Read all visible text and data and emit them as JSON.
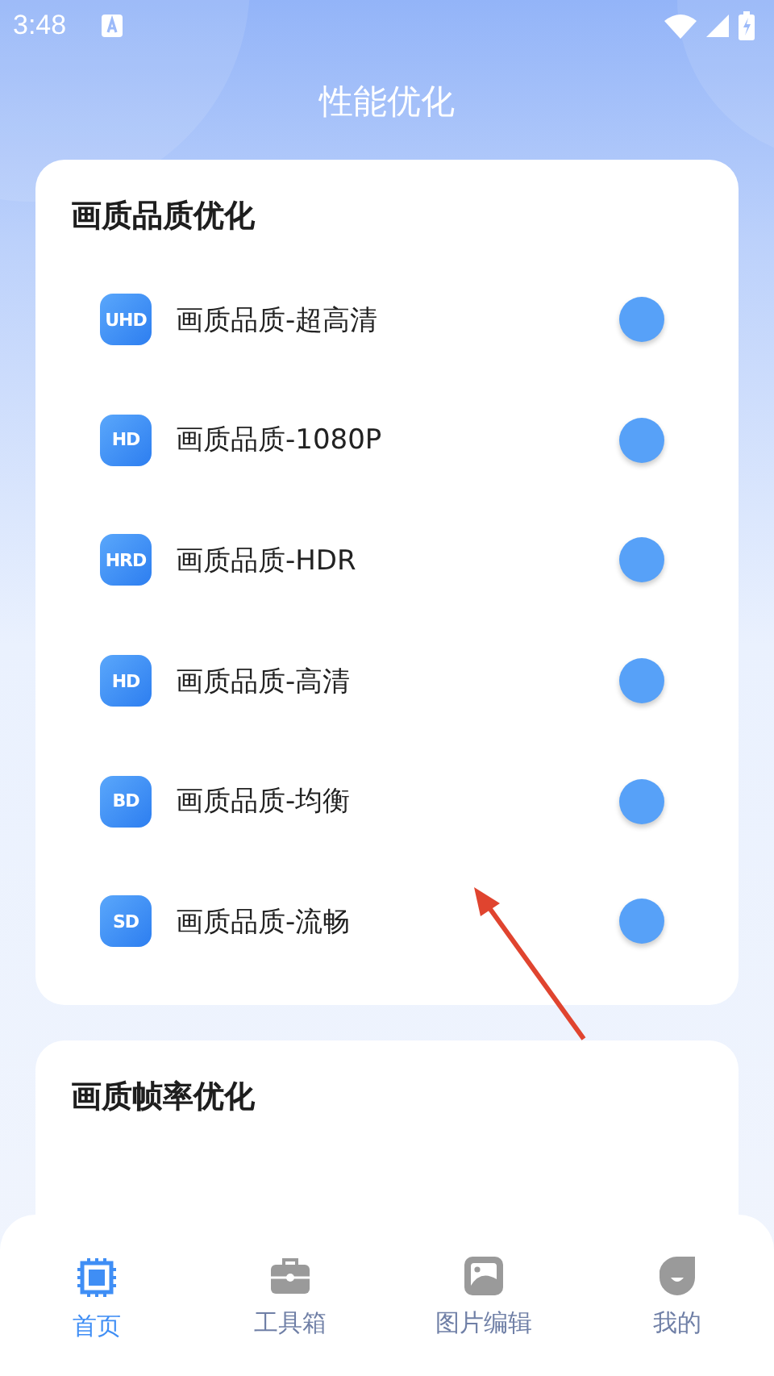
{
  "status_bar": {
    "time": "3:48"
  },
  "header": {
    "title": "性能优化"
  },
  "quality_card": {
    "title": "画质品质优化",
    "items": [
      {
        "badge": "UHD",
        "label": "画质品质-超高清",
        "on": false
      },
      {
        "badge": "HD",
        "label": "画质品质-1080P",
        "on": false
      },
      {
        "badge": "HRD",
        "label": "画质品质-HDR",
        "on": false
      },
      {
        "badge": "HD",
        "label": "画质品质-高清",
        "on": false
      },
      {
        "badge": "BD",
        "label": "画质品质-均衡",
        "on": false
      },
      {
        "badge": "SD",
        "label": "画质品质-流畅",
        "on": false
      }
    ]
  },
  "framerate_card": {
    "title": "画质帧率优化"
  },
  "bottom_nav": [
    {
      "kind": "chip",
      "label": "首页",
      "selected": true
    },
    {
      "kind": "toolbox",
      "label": "工具箱",
      "selected": false
    },
    {
      "kind": "image",
      "label": "图片编辑",
      "selected": false
    },
    {
      "kind": "face",
      "label": "我的",
      "selected": false
    }
  ]
}
